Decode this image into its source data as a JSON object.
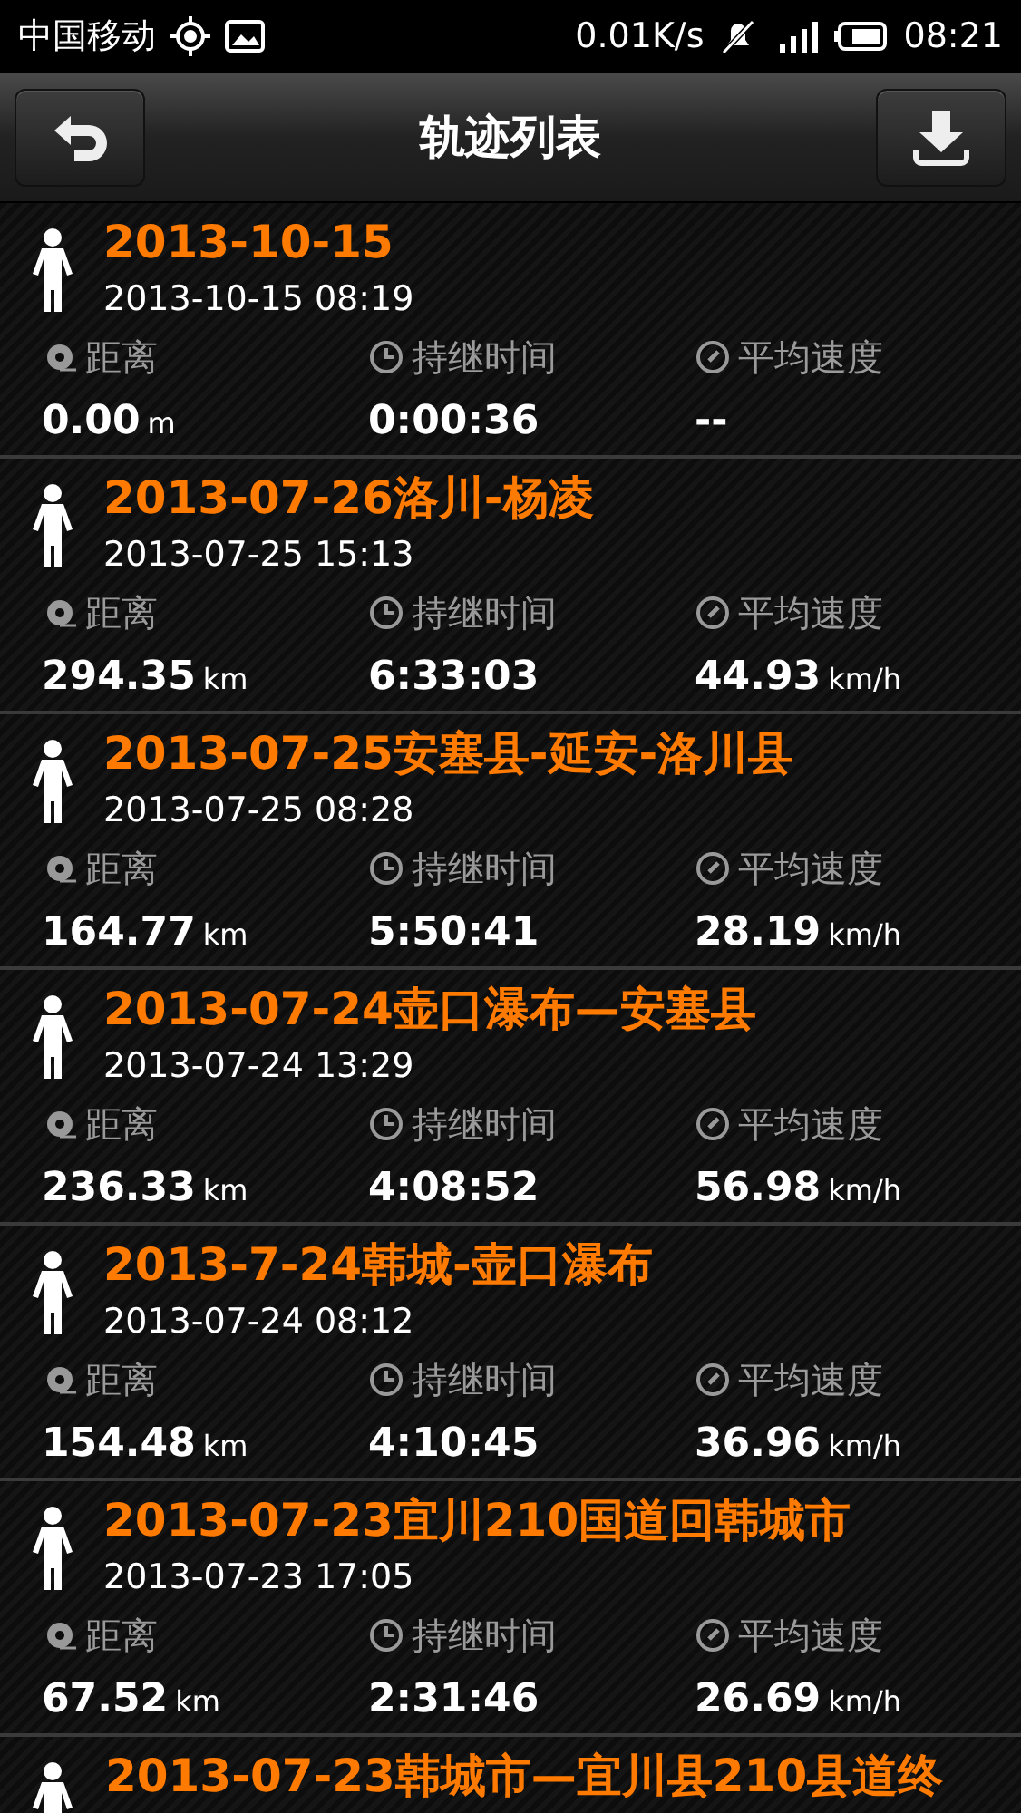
{
  "status_bar": {
    "carrier": "中国移动",
    "speed": "0.01K/s",
    "time": "08:21"
  },
  "toolbar": {
    "title": "轨迹列表"
  },
  "tracks": [
    {
      "title": "2013-10-15",
      "date": "2013-10-15 08:19",
      "labels": [
        "距离",
        "持继时间",
        "平均速度"
      ],
      "distance": "0.00",
      "distance_unit": "m",
      "duration": "0:00:36",
      "speed": "--"
    },
    {
      "title": "2013-07-26洛川-杨凌",
      "date": "2013-07-25 15:13",
      "labels": [
        "距离",
        "持继时间",
        "平均速度"
      ],
      "distance": "294.35",
      "distance_unit": "km",
      "duration": "6:33:03",
      "speed": "44.93",
      "speed_unit": "km/h"
    },
    {
      "title": "2013-07-25安塞县-延安-洛川县",
      "date": "2013-07-25 08:28",
      "labels": [
        "距离",
        "持继时间",
        "平均速度"
      ],
      "distance": "164.77",
      "distance_unit": "km",
      "duration": "5:50:41",
      "speed": "28.19",
      "speed_unit": "km/h"
    },
    {
      "title": "2013-07-24壶口瀑布—安塞县",
      "date": "2013-07-24 13:29",
      "labels": [
        "距离",
        "持继时间",
        "平均速度"
      ],
      "distance": "236.33",
      "distance_unit": "km",
      "duration": "4:08:52",
      "speed": "56.98",
      "speed_unit": "km/h"
    },
    {
      "title": "2013-7-24韩城-壶口瀑布",
      "date": "2013-07-24 08:12",
      "labels": [
        "距离",
        "持继时间",
        "平均速度"
      ],
      "distance": "154.48",
      "distance_unit": "km",
      "duration": "4:10:45",
      "speed": "36.96",
      "speed_unit": "km/h"
    },
    {
      "title": "2013-07-23宜川210国道回韩城市",
      "date": "2013-07-23 17:05",
      "labels": [
        "距离",
        "持继时间",
        "平均速度"
      ],
      "distance": "67.52",
      "distance_unit": "km",
      "duration": "2:31:46",
      "speed": "26.69",
      "speed_unit": "km/h"
    },
    {
      "title": "2013-07-23韩城市—宜川县210县道终"
    }
  ]
}
